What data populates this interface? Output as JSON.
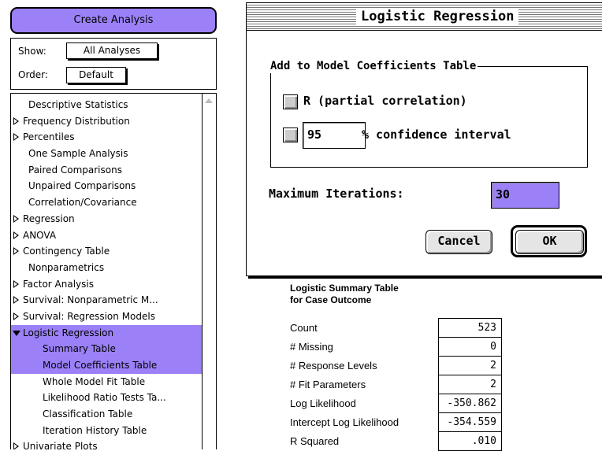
{
  "left_panel": {
    "create_button": "Create Analysis",
    "show_label": "Show:",
    "show_value": "All Analyses",
    "order_label": "Order:",
    "order_value": "Default",
    "items": [
      {
        "label": "Descriptive Statistics",
        "type": "leaf",
        "selected": false
      },
      {
        "label": "Frequency Distribution",
        "type": "collapsed",
        "selected": false
      },
      {
        "label": "Percentiles",
        "type": "collapsed",
        "selected": false
      },
      {
        "label": "One Sample Analysis",
        "type": "leaf",
        "selected": false
      },
      {
        "label": "Paired Comparisons",
        "type": "leaf",
        "selected": false
      },
      {
        "label": "Unpaired Comparisons",
        "type": "leaf",
        "selected": false
      },
      {
        "label": "Correlation/Covariance",
        "type": "leaf",
        "selected": false
      },
      {
        "label": "Regression",
        "type": "collapsed",
        "selected": false
      },
      {
        "label": "ANOVA",
        "type": "collapsed",
        "selected": false
      },
      {
        "label": "Contingency Table",
        "type": "collapsed",
        "selected": false
      },
      {
        "label": "Nonparametrics",
        "type": "leaf",
        "selected": false
      },
      {
        "label": "Factor Analysis",
        "type": "collapsed",
        "selected": false
      },
      {
        "label": "Survival: Nonparametric M...",
        "type": "collapsed",
        "selected": false
      },
      {
        "label": "Survival: Regression Models",
        "type": "collapsed",
        "selected": false
      },
      {
        "label": "Logistic Regression",
        "type": "expanded",
        "selected": true
      },
      {
        "label": "Summary Table",
        "type": "child",
        "selected": true
      },
      {
        "label": "Model Coefficients Table",
        "type": "child",
        "selected": true
      },
      {
        "label": "Whole Model Fit Table",
        "type": "child",
        "selected": false
      },
      {
        "label": "Likelihood Ratio Tests Ta...",
        "type": "child",
        "selected": false
      },
      {
        "label": "Classification Table",
        "type": "child",
        "selected": false
      },
      {
        "label": "Iteration History Table",
        "type": "child",
        "selected": false
      },
      {
        "label": "Univariate Plots",
        "type": "collapsed",
        "selected": false
      }
    ]
  },
  "dialog": {
    "title": "Logistic Regression",
    "group_title": "Add to Model Coefficients Table",
    "checkbox_r_label": "R (partial correlation)",
    "confidence_value": "95",
    "confidence_label": "% confidence interval",
    "max_iter_label": "Maximum Iterations:",
    "max_iter_value": "30",
    "cancel_label": "Cancel",
    "ok_label": "OK"
  },
  "summary": {
    "title_line1": "Logistic Summary Table",
    "title_line2": "for Case Outcome",
    "rows": [
      {
        "label": "Count",
        "value": "523"
      },
      {
        "label": "# Missing",
        "value": "0"
      },
      {
        "label": "# Response Levels",
        "value": "2"
      },
      {
        "label": "# Fit Parameters",
        "value": "2"
      },
      {
        "label": "Log Likelihood",
        "value": "-350.862"
      },
      {
        "label": "Intercept Log Likelihood",
        "value": "-354.559"
      },
      {
        "label": "R Squared",
        "value": ".010"
      }
    ]
  },
  "colors": {
    "selection": "#9b80f8"
  }
}
